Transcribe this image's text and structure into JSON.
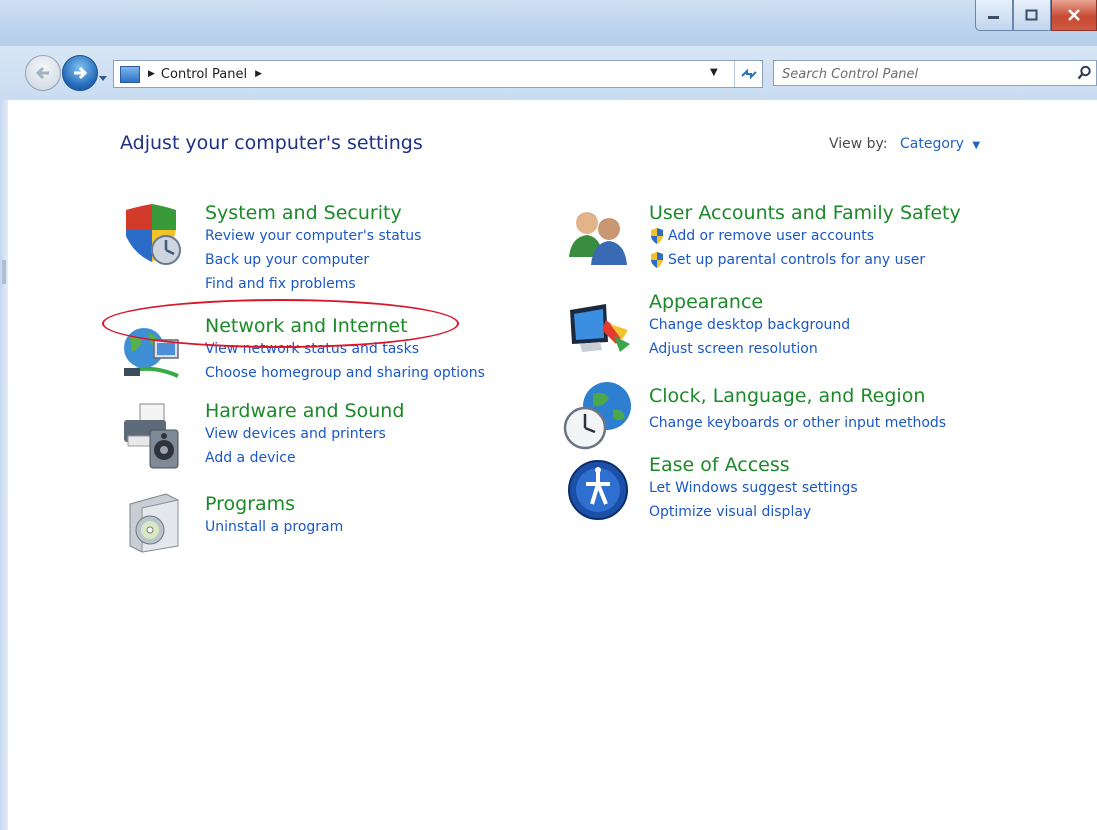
{
  "window": {
    "controls": {
      "minimize": "minimize",
      "maximize": "maximize",
      "close": "close"
    }
  },
  "address_bar": {
    "breadcrumb": [
      "Control Panel"
    ],
    "search_placeholder": "Search Control Panel"
  },
  "content": {
    "heading": "Adjust your computer's settings",
    "view_by_label": "View by:",
    "view_by_value": "Category"
  },
  "categories": [
    {
      "title": "System and Security",
      "links": [
        "Review your computer's status",
        "Back up your computer",
        "Find and fix problems"
      ]
    },
    {
      "title": "Network and Internet",
      "links": [
        "View network status and tasks",
        "Choose homegroup and sharing options"
      ]
    },
    {
      "title": "Hardware and Sound",
      "links": [
        "View devices and printers",
        "Add a device"
      ]
    },
    {
      "title": "Programs",
      "links": [
        "Uninstall a program"
      ]
    },
    {
      "title": "User Accounts and Family Safety",
      "links": [
        "Add or remove user accounts",
        "Set up parental controls for any user"
      ]
    },
    {
      "title": "Appearance",
      "links": [
        "Change desktop background",
        "Adjust screen resolution"
      ]
    },
    {
      "title": "Clock, Language, and Region",
      "links": [
        "Change keyboards or other input methods"
      ]
    },
    {
      "title": "Ease of Access",
      "links": [
        "Let Windows suggest settings",
        "Optimize visual display"
      ]
    }
  ],
  "icons": {
    "system_security": "shield-icon",
    "network": "network-globe-icon",
    "hardware": "printer-speaker-icon",
    "programs": "programs-disc-icon",
    "users": "users-icon",
    "appearance": "monitor-brush-icon",
    "clock": "globe-clock-icon",
    "ease": "ease-of-access-icon"
  },
  "colors": {
    "category_title": "#1b8a27",
    "link": "#1a58c6",
    "heading": "#1e3287",
    "annotation": "#d9172b"
  }
}
